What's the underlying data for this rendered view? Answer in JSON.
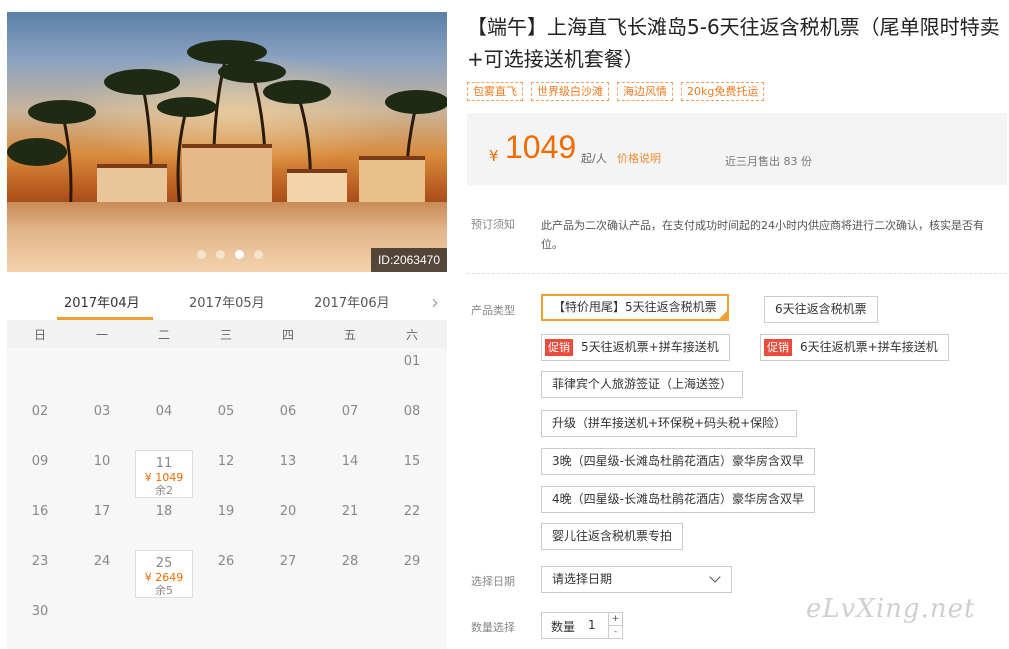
{
  "photo": {
    "id_label": "ID:2063470",
    "carousel_dots": 4,
    "active_dot": 3
  },
  "calendar": {
    "tabs": [
      "2017年04月",
      "2017年05月",
      "2017年06月"
    ],
    "active_tab": 0,
    "weekdays": [
      "日",
      "一",
      "二",
      "三",
      "四",
      "五",
      "六"
    ],
    "days": [
      {
        "day": "01",
        "row": 0,
        "col": 6
      },
      {
        "day": "02",
        "row": 1,
        "col": 0
      },
      {
        "day": "03",
        "row": 1,
        "col": 1
      },
      {
        "day": "04",
        "row": 1,
        "col": 2
      },
      {
        "day": "05",
        "row": 1,
        "col": 3
      },
      {
        "day": "06",
        "row": 1,
        "col": 4
      },
      {
        "day": "07",
        "row": 1,
        "col": 5
      },
      {
        "day": "08",
        "row": 1,
        "col": 6
      },
      {
        "day": "09",
        "row": 2,
        "col": 0
      },
      {
        "day": "10",
        "row": 2,
        "col": 1
      },
      {
        "day": "11",
        "row": 2,
        "col": 2,
        "price": "¥ 1049",
        "stock": "余2"
      },
      {
        "day": "12",
        "row": 2,
        "col": 3
      },
      {
        "day": "13",
        "row": 2,
        "col": 4
      },
      {
        "day": "14",
        "row": 2,
        "col": 5
      },
      {
        "day": "15",
        "row": 2,
        "col": 6
      },
      {
        "day": "16",
        "row": 3,
        "col": 0
      },
      {
        "day": "17",
        "row": 3,
        "col": 1
      },
      {
        "day": "18",
        "row": 3,
        "col": 2
      },
      {
        "day": "19",
        "row": 3,
        "col": 3
      },
      {
        "day": "20",
        "row": 3,
        "col": 4
      },
      {
        "day": "21",
        "row": 3,
        "col": 5
      },
      {
        "day": "22",
        "row": 3,
        "col": 6
      },
      {
        "day": "23",
        "row": 4,
        "col": 0
      },
      {
        "day": "24",
        "row": 4,
        "col": 1
      },
      {
        "day": "25",
        "row": 4,
        "col": 2,
        "price": "¥ 2649",
        "stock": "余5"
      },
      {
        "day": "26",
        "row": 4,
        "col": 3
      },
      {
        "day": "27",
        "row": 4,
        "col": 4
      },
      {
        "day": "28",
        "row": 4,
        "col": 5
      },
      {
        "day": "29",
        "row": 4,
        "col": 6
      },
      {
        "day": "30",
        "row": 5,
        "col": 0
      }
    ]
  },
  "product": {
    "title": "【端午】上海直飞长滩岛5-6天往返含税机票（尾单限时特卖+可选接送机套餐）",
    "tags": [
      "包雾直飞",
      "世界级白沙滩",
      "海边风情",
      "20kg免费托运"
    ],
    "price_currency": "¥",
    "price_amount": "1049",
    "price_unit": "起/人",
    "price_note_link": "价格说明",
    "sold_text": "近三月售出 83 份"
  },
  "notice": {
    "label": "预订须知",
    "text": "此产品为二次确认产品，在支付成功时间起的24小时内供应商将进行二次确认，核实是否有位。"
  },
  "options": {
    "label": "产品类型",
    "promo_badge": "促销",
    "items": [
      {
        "label": "【特价甩尾】5天往返含税机票",
        "selected": true,
        "promo": false
      },
      {
        "label": "6天往返含税机票",
        "selected": false,
        "promo": false
      },
      {
        "label": "5天往返机票+拼车接送机",
        "selected": false,
        "promo": true
      },
      {
        "label": "6天往返机票+拼车接送机",
        "selected": false,
        "promo": true
      },
      {
        "label": "菲律宾个人旅游签证（上海送签）",
        "selected": false,
        "promo": false
      },
      {
        "label": "升级（拼车接送机+环保税+码头税+保险）",
        "selected": false,
        "promo": false
      },
      {
        "label": "3晚（四星级-长滩岛杜鹃花酒店）豪华房含双早",
        "selected": false,
        "promo": false
      },
      {
        "label": "4晚（四星级-长滩岛杜鹃花酒店）豪华房含双早",
        "selected": false,
        "promo": false
      },
      {
        "label": "婴儿往返含税机票专拍",
        "selected": false,
        "promo": false
      }
    ]
  },
  "date_select": {
    "label": "选择日期",
    "placeholder": "请选择日期"
  },
  "quantity": {
    "label": "数量选择",
    "field_label": "数量",
    "value": "1",
    "plus": "+",
    "minus": "-"
  },
  "watermark": "eLvXing.net"
}
